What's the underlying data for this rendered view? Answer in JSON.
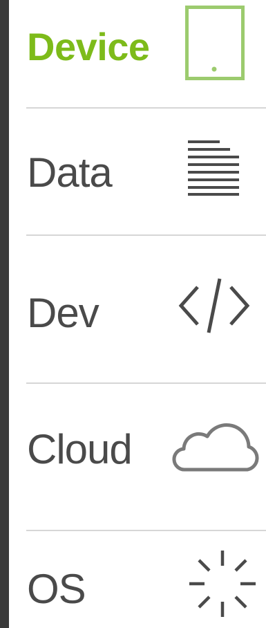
{
  "nav": {
    "items": [
      {
        "label": "Device",
        "icon": "tablet-icon",
        "active": true
      },
      {
        "label": "Data",
        "icon": "text-lines-icon",
        "active": false
      },
      {
        "label": "Dev",
        "icon": "code-icon",
        "active": false
      },
      {
        "label": "Cloud",
        "icon": "cloud-icon",
        "active": false
      },
      {
        "label": "OS",
        "icon": "loading-spinner-icon",
        "active": false
      }
    ]
  },
  "colors": {
    "active": "#7dbb1a",
    "active_icon": "#9ccb6e",
    "text": "#4a4a4a",
    "icon": "#4a4a4a",
    "divider": "#d6d6d6",
    "left_bar": "#3a3a3a"
  }
}
